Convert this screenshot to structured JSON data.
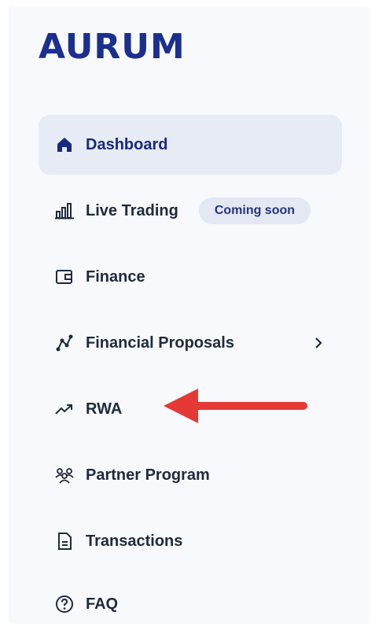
{
  "brand": {
    "logo_text": "AURUM",
    "color": "#1b2f8f"
  },
  "sidebar": {
    "items": [
      {
        "label": "Dashboard",
        "icon": "home-icon",
        "active": true
      },
      {
        "label": "Live Trading",
        "icon": "bar-chart-icon",
        "badge": "Coming soon"
      },
      {
        "label": "Finance",
        "icon": "wallet-icon"
      },
      {
        "label": "Financial Proposals",
        "icon": "nodes-icon",
        "has_submenu": true
      },
      {
        "label": "RWA",
        "icon": "trending-up-icon"
      },
      {
        "label": "Partner Program",
        "icon": "users-icon"
      },
      {
        "label": "Transactions",
        "icon": "file-icon"
      },
      {
        "label": "FAQ",
        "icon": "help-circle-icon"
      }
    ]
  },
  "colors": {
    "active_background": "#e7ebf6",
    "label_text": "#1f2a3d",
    "annotation_arrow": "#e53935"
  }
}
